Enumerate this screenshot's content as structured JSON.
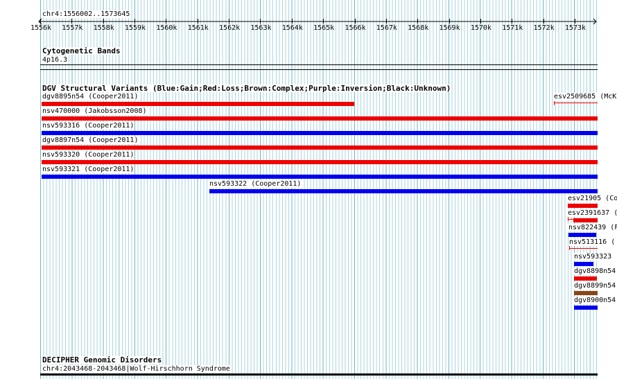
{
  "ruler": {
    "position_label": "chr4:1556002..1573645",
    "ticks": [
      "1556k",
      "1557k",
      "1558k",
      "1559k",
      "1560k",
      "1561k",
      "1562k",
      "1563k",
      "1564k",
      "1565k",
      "1566k",
      "1567k",
      "1568k",
      "1569k",
      "1570k",
      "1571k",
      "1572k",
      "1573k"
    ]
  },
  "cytobands": {
    "title": "Cytogenetic Bands",
    "band": "4p16.3"
  },
  "dgv": {
    "title": "DGV Structural Variants (Blue:Gain;Red:Loss;Brown:Complex;Purple:Inversion;Black:Unknown)",
    "colors": {
      "gain": "#0000ee",
      "loss": "#ee0000",
      "complex": "#8b4513"
    },
    "variants": [
      {
        "label": "dgv8895n54 (Cooper2011)",
        "type": "loss"
      },
      {
        "label": "esv2509685 (McKe",
        "type": "loss"
      },
      {
        "label": "nsv470000 (Jakobsson2008)",
        "type": "loss"
      },
      {
        "label": "nsv593316 (Cooper2011)",
        "type": "gain"
      },
      {
        "label": "dgv8897n54 (Cooper2011)",
        "type": "loss"
      },
      {
        "label": "nsv593320 (Cooper2011)",
        "type": "loss"
      },
      {
        "label": "nsv593321 (Cooper2011)",
        "type": "gain"
      },
      {
        "label": "nsv593322 (Cooper2011)",
        "type": "gain"
      },
      {
        "label": "esv21905 (Co",
        "type": "loss"
      },
      {
        "label": "esv2391637 (",
        "type": "loss"
      },
      {
        "label": "nsv822439 (F",
        "type": "gain"
      },
      {
        "label": "nsv513116 (",
        "type": "loss"
      },
      {
        "label": "nsv593323 (",
        "type": "gain"
      },
      {
        "label": "dgv8898n54",
        "type": "loss"
      },
      {
        "label": "dgv8899n54",
        "type": "complex"
      },
      {
        "label": "dgv8900n54",
        "type": "gain"
      }
    ]
  },
  "decipher": {
    "title": "DECIPHER Genomic Disorders",
    "entry": "chr4:2043468-2043468|Wolf-Hirschhorn Syndrome"
  }
}
